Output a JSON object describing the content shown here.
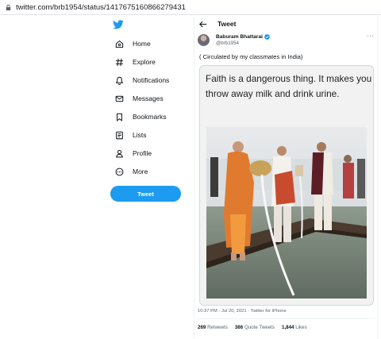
{
  "browser": {
    "url": "twitter.com/brb1954/status/1417675160866279431"
  },
  "sidebar": {
    "logo": "twitter-bird-icon",
    "items": [
      {
        "label": "Home",
        "icon": "home-icon"
      },
      {
        "label": "Explore",
        "icon": "hashtag-icon"
      },
      {
        "label": "Notifications",
        "icon": "bell-icon"
      },
      {
        "label": "Messages",
        "icon": "envelope-icon"
      },
      {
        "label": "Bookmarks",
        "icon": "bookmark-icon"
      },
      {
        "label": "Lists",
        "icon": "list-icon"
      },
      {
        "label": "Profile",
        "icon": "person-icon"
      },
      {
        "label": "More",
        "icon": "more-circle-icon"
      }
    ],
    "tweet_button": "Tweet"
  },
  "header": {
    "title": "Tweet"
  },
  "tweet": {
    "author_name": "Baburam Bhattarai",
    "author_handle": "@brb1954",
    "text": "( Circulated by my classmates in India)",
    "image_caption": "Faith is a dangerous thing. It makes you throw away milk and drink urine.",
    "time": "10:37 PM · Jul 20, 2021",
    "separator": " · ",
    "source": "Twitter for iPhone",
    "retweets_count": "269",
    "retweets_label": "Retweets",
    "quotes_count": "386",
    "quotes_label": "Quote Tweets",
    "likes_count": "1,844",
    "likes_label": "Likes"
  },
  "colors": {
    "accent": "#1d9bf0",
    "text": "#0f1419",
    "muted": "#536471"
  }
}
